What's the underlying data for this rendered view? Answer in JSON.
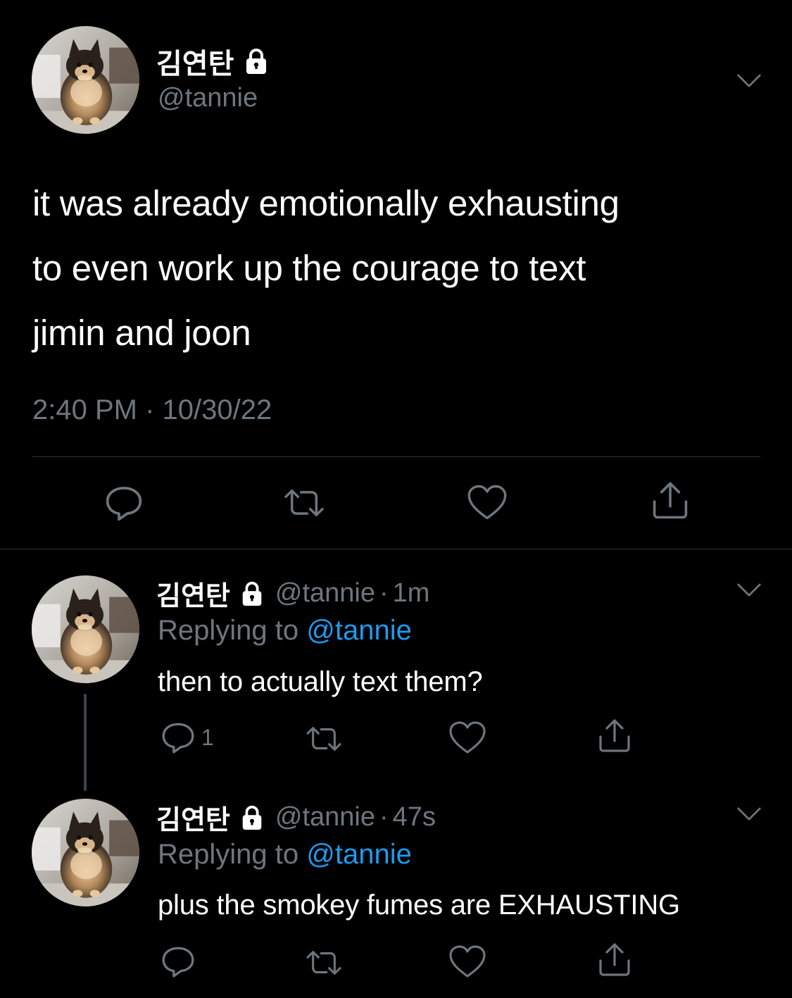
{
  "colors": {
    "background": "#000000",
    "primary_text": "#ffffff",
    "secondary_text": "#6e767d",
    "accent": "#1d9bf0",
    "divider": "#2f3336"
  },
  "main_tweet": {
    "display_name": "김연탄",
    "handle": "@tannie",
    "text_lines": [
      "it was already emotionally exhausting",
      "to even work up the courage to text",
      "jimin and joon"
    ],
    "time": "2:40 PM",
    "separator": "·",
    "date": "10/30/22",
    "icons": {
      "protected": "lock-icon",
      "menu": "chevron-down-icon",
      "reply": "reply-icon",
      "retweet": "retweet-icon",
      "like": "heart-icon",
      "share": "share-icon"
    }
  },
  "replies": [
    {
      "display_name": "김연탄",
      "handle": "@tannie",
      "separator": "·",
      "time": "1m",
      "replying_prefix": "Replying to",
      "replying_to": "@tannie",
      "text": "then to actually text them?",
      "reply_count": "1"
    },
    {
      "display_name": "김연탄",
      "handle": "@tannie",
      "separator": "·",
      "time": "47s",
      "replying_prefix": "Replying to",
      "replying_to": "@tannie",
      "text": "plus the smokey fumes are EXHAUSTING",
      "reply_count": ""
    }
  ]
}
